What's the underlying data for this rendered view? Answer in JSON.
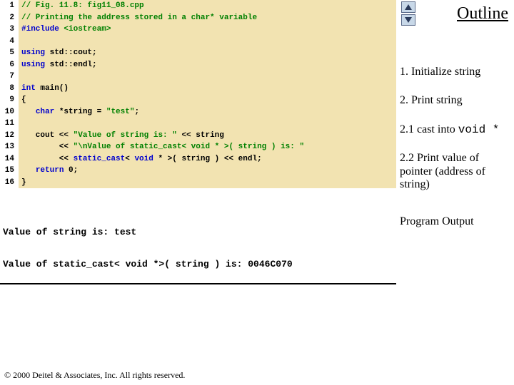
{
  "code": {
    "lines": [
      {
        "n": "1",
        "frag": [
          {
            "t": "// Fig. 11.8: fig11_08.cpp",
            "c": "comment"
          }
        ]
      },
      {
        "n": "2",
        "frag": [
          {
            "t": "// Printing the address stored in a char* variable",
            "c": "comment"
          }
        ]
      },
      {
        "n": "3",
        "frag": [
          {
            "t": "#include ",
            "c": "pp"
          },
          {
            "t": "<iostream>",
            "c": "angled"
          }
        ]
      },
      {
        "n": "4",
        "frag": [
          {
            "t": "",
            "c": ""
          }
        ]
      },
      {
        "n": "5",
        "frag": [
          {
            "t": "using ",
            "c": "kw"
          },
          {
            "t": "std::cout;",
            "c": ""
          }
        ]
      },
      {
        "n": "6",
        "frag": [
          {
            "t": "using ",
            "c": "kw"
          },
          {
            "t": "std::endl;",
            "c": ""
          }
        ]
      },
      {
        "n": "7",
        "frag": [
          {
            "t": "",
            "c": ""
          }
        ]
      },
      {
        "n": "8",
        "frag": [
          {
            "t": "int ",
            "c": "kw"
          },
          {
            "t": "main()",
            "c": ""
          }
        ]
      },
      {
        "n": "9",
        "frag": [
          {
            "t": "{",
            "c": ""
          }
        ]
      },
      {
        "n": "10",
        "frag": [
          {
            "t": "   ",
            "c": ""
          },
          {
            "t": "char ",
            "c": "kw"
          },
          {
            "t": "*string = ",
            "c": ""
          },
          {
            "t": "\"test\"",
            "c": "angled"
          },
          {
            "t": ";",
            "c": ""
          }
        ]
      },
      {
        "n": "11",
        "frag": [
          {
            "t": "",
            "c": ""
          }
        ]
      },
      {
        "n": "12",
        "frag": [
          {
            "t": "   cout << ",
            "c": ""
          },
          {
            "t": "\"Value of string is: \"",
            "c": "angled"
          },
          {
            "t": " << string",
            "c": ""
          }
        ]
      },
      {
        "n": "13",
        "frag": [
          {
            "t": "        << ",
            "c": ""
          },
          {
            "t": "\"\\nValue of static_cast< void * >( string ) is: \"",
            "c": "angled"
          }
        ]
      },
      {
        "n": "14",
        "frag": [
          {
            "t": "        << ",
            "c": ""
          },
          {
            "t": "static_cast",
            "c": "kw"
          },
          {
            "t": "< ",
            "c": ""
          },
          {
            "t": "void ",
            "c": "kw"
          },
          {
            "t": "* >( string ) << endl;",
            "c": ""
          }
        ]
      },
      {
        "n": "15",
        "frag": [
          {
            "t": "   ",
            "c": ""
          },
          {
            "t": "return ",
            "c": "kw"
          },
          {
            "t": "0;",
            "c": ""
          }
        ]
      },
      {
        "n": "16",
        "frag": [
          {
            "t": "}",
            "c": ""
          }
        ]
      }
    ]
  },
  "output": {
    "line1": "Value of string is: test",
    "line2": "Value of static_cast< void *>( string ) is: 0046C070"
  },
  "outline": {
    "title": "Outline",
    "items": [
      "1. Initialize string",
      "2. Print string",
      "2.1 cast into void *",
      "2.2 Print value of pointer (address of string)",
      "Program Output"
    ]
  },
  "footer": "© 2000 Deitel & Associates, Inc.  All rights reserved."
}
